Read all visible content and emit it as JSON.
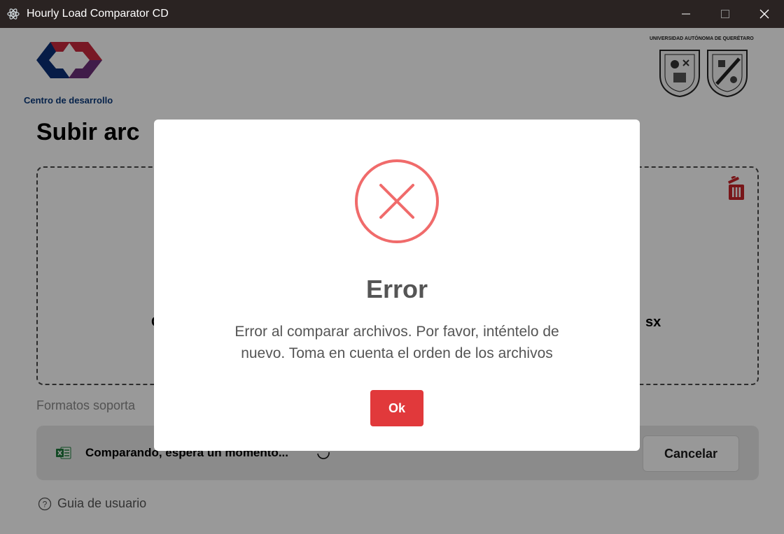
{
  "window": {
    "title": "Hourly Load Comparator CD",
    "app_icon": "atom-icon",
    "controls": [
      "minimize-icon",
      "maximize-icon",
      "close-icon"
    ]
  },
  "header": {
    "left_logo_caption": "Centro de desarrollo",
    "right_logo_caption": "UNIVERSIDAD AUTÓNOMA DE QUERÉTARO",
    "left_logo_colors": [
      "#c8283d",
      "#0b2f77",
      "#6b2f7a"
    ]
  },
  "main": {
    "title": "Subir arc",
    "dropzone": {
      "left_fragment": "C",
      "right_fragment": "sx",
      "trash_icon": "trash-icon"
    },
    "formats_text": "Formatos soporta",
    "progress": {
      "icon": "excel-icon",
      "text": "Comparando, espera un momento...",
      "spinner_icon": "spinner-icon",
      "cancel_label": "Cancelar"
    },
    "guide": {
      "icon": "help-circle-icon",
      "label": "Guia de usuario"
    }
  },
  "modal": {
    "icon": "error-x-icon",
    "title": "Error",
    "message_line1": "Error al comparar archivos. Por favor, inténtelo de",
    "message_line2": "nuevo. Toma en cuenta el orden de los archivos",
    "ok_label": "Ok"
  },
  "colors": {
    "titlebar": "#2a2322",
    "error_red": "#f06b6b",
    "ok_button": "#e1393b",
    "trash_red": "#c8262a",
    "overlay": "rgba(0,0,0,0.40)"
  }
}
